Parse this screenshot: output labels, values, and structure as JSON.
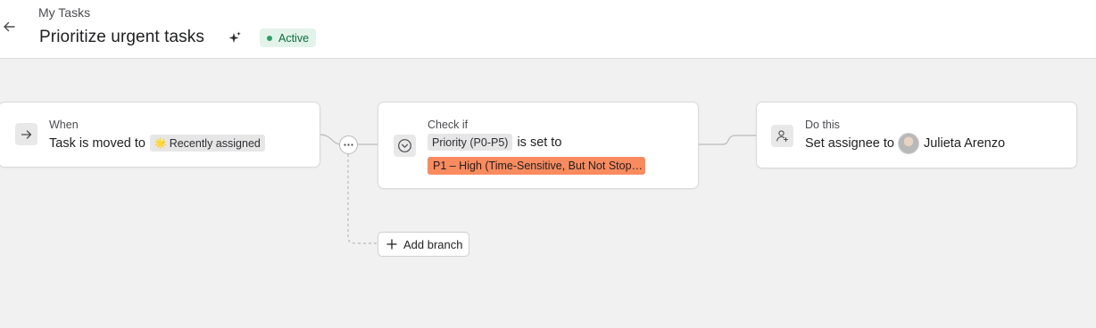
{
  "header": {
    "breadcrumb": "My Tasks",
    "title": "Prioritize urgent tasks",
    "status": "Active"
  },
  "rules": {
    "trigger": {
      "label": "When",
      "prefix": "Task is moved to",
      "section_emoji": "🌟",
      "section": "Recently assigned"
    },
    "condition": {
      "label": "Check if",
      "field": "Priority (P0-P5)",
      "connector": "is set to",
      "value": "P1 – High (Time-Sensitive, But Not Stop…"
    },
    "action": {
      "label": "Do this",
      "prefix": "Set assignee to",
      "assignee": "Julieta Arenzo"
    }
  },
  "branch": {
    "add_label": "Add branch"
  },
  "colors": {
    "active_badge_bg": "#e3f3ea",
    "active_badge_text": "#0d6b3e",
    "priority_chip": "#f98b5f"
  }
}
